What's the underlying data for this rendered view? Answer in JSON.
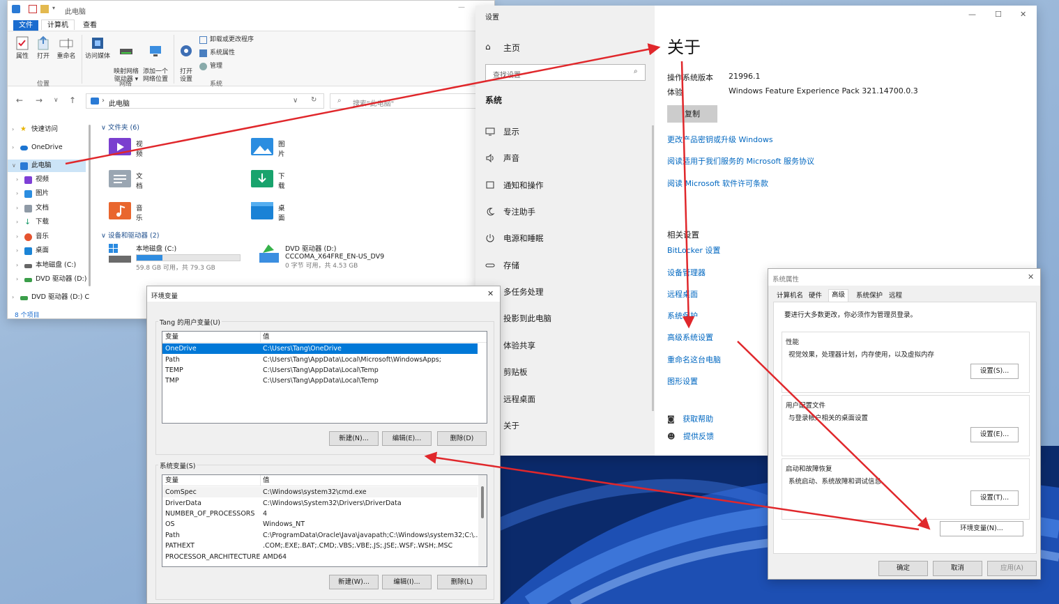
{
  "explorer": {
    "title": "此电脑",
    "ribbon_tabs": [
      "文件",
      "计算机",
      "查看"
    ],
    "ribbon": {
      "location": {
        "label": "位置",
        "buttons": [
          "属性",
          "打开",
          "重命名"
        ]
      },
      "network": {
        "label": "网络",
        "buttons": [
          "访问媒体",
          "映射网络\n驱动器 ▾",
          "添加一个\n网络位置"
        ]
      },
      "system": {
        "label": "系统",
        "open_settings": "打开\n设置",
        "uninstall": "卸载或更改程序",
        "sys_props": "系统属性",
        "manage": "管理"
      }
    },
    "address": "此电脑",
    "search_placeholder": "搜索\"此电脑\"",
    "nav": [
      "快速访问",
      "OneDrive",
      "此电脑",
      "视频",
      "图片",
      "文档",
      "下载",
      "音乐",
      "桌面",
      "本地磁盘 (C:)",
      "DVD 驱动器 (D:)",
      "DVD 驱动器 (D:) C"
    ],
    "folders_header": "文件夹 (6)",
    "folders": [
      "视频",
      "图片",
      "文档",
      "下载",
      "音乐",
      "桌面"
    ],
    "drives_header": "设备和驱动器 (2)",
    "drive_c": {
      "name": "本地磁盘 (C:)",
      "free": "59.8 GB 可用，共 79.3 GB",
      "used_fraction": 0.25
    },
    "drive_d": {
      "name": "DVD 驱动器 (D:)",
      "label": "CCCOMA_X64FRE_EN-US_DV9",
      "free": "0 字节 可用，共 4.53 GB"
    },
    "status": "8 个项目"
  },
  "settings": {
    "app_title": "设置",
    "home": "主页",
    "search_placeholder": "查找设置",
    "group": "系统",
    "nav": [
      "显示",
      "声音",
      "通知和操作",
      "专注助手",
      "电源和睡眠",
      "存储",
      "多任务处理",
      "投影到此电脑",
      "体验共享",
      "剪贴板",
      "远程桌面",
      "关于"
    ],
    "heading": "关于",
    "specs": [
      {
        "label": "操作系统版本",
        "value": "21996.1"
      },
      {
        "label": "体验",
        "value": "Windows Feature Experience Pack 321.14700.0.3"
      }
    ],
    "copy": "复制",
    "links": [
      "更改产品密钥或升级 Windows",
      "阅读适用于我们服务的 Microsoft 服务协议",
      "阅读 Microsoft 软件许可条款"
    ],
    "related_heading": "相关设置",
    "related": [
      "BitLocker 设置",
      "设备管理器",
      "远程桌面",
      "系统保护",
      "高级系统设置",
      "重命名这台电脑",
      "图形设置"
    ],
    "help": "获取帮助",
    "feedback": "提供反馈"
  },
  "envvars": {
    "title": "环境变量",
    "user_group": "Tang 的用户变量(U)",
    "col_var": "变量",
    "col_val": "值",
    "user_vars": [
      {
        "name": "OneDrive",
        "value": "C:\\Users\\Tang\\OneDrive"
      },
      {
        "name": "Path",
        "value": "C:\\Users\\Tang\\AppData\\Local\\Microsoft\\WindowsApps;"
      },
      {
        "name": "TEMP",
        "value": "C:\\Users\\Tang\\AppData\\Local\\Temp"
      },
      {
        "name": "TMP",
        "value": "C:\\Users\\Tang\\AppData\\Local\\Temp"
      }
    ],
    "user_buttons": [
      "新建(N)...",
      "编辑(E)...",
      "删除(D)"
    ],
    "sys_group": "系统变量(S)",
    "sys_vars": [
      {
        "name": "ComSpec",
        "value": "C:\\Windows\\system32\\cmd.exe"
      },
      {
        "name": "DriverData",
        "value": "C:\\Windows\\System32\\Drivers\\DriverData"
      },
      {
        "name": "NUMBER_OF_PROCESSORS",
        "value": "4"
      },
      {
        "name": "OS",
        "value": "Windows_NT"
      },
      {
        "name": "Path",
        "value": "C:\\ProgramData\\Oracle\\Java\\javapath;C:\\Windows\\system32;C:\\..."
      },
      {
        "name": "PATHEXT",
        "value": ".COM;.EXE;.BAT;.CMD;.VBS;.VBE;.JS;.JSE;.WSF;.WSH;.MSC"
      },
      {
        "name": "PROCESSOR_ARCHITECTURE",
        "value": "AMD64"
      }
    ],
    "sys_buttons": [
      "新建(W)...",
      "编辑(I)...",
      "删除(L)"
    ]
  },
  "sysprops": {
    "title": "系统属性",
    "tabs": [
      "计算机名",
      "硬件",
      "高级",
      "系统保护",
      "远程"
    ],
    "note": "要进行大多数更改，你必须作为管理员登录。",
    "performance": {
      "title": "性能",
      "desc": "视觉效果，处理器计划，内存使用，以及虚拟内存",
      "button": "设置(S)..."
    },
    "profiles": {
      "title": "用户配置文件",
      "desc": "与登录帐户相关的桌面设置",
      "button": "设置(E)..."
    },
    "startup": {
      "title": "启动和故障恢复",
      "desc": "系统启动、系统故障和调试信息",
      "button": "设置(T)..."
    },
    "env_button": "环境变量(N)...",
    "ok": "确定",
    "cancel": "取消",
    "apply": "应用(A)"
  },
  "colors": {
    "accent": "#0078d7",
    "link": "#0067c0",
    "arrow": "#e0272b"
  }
}
